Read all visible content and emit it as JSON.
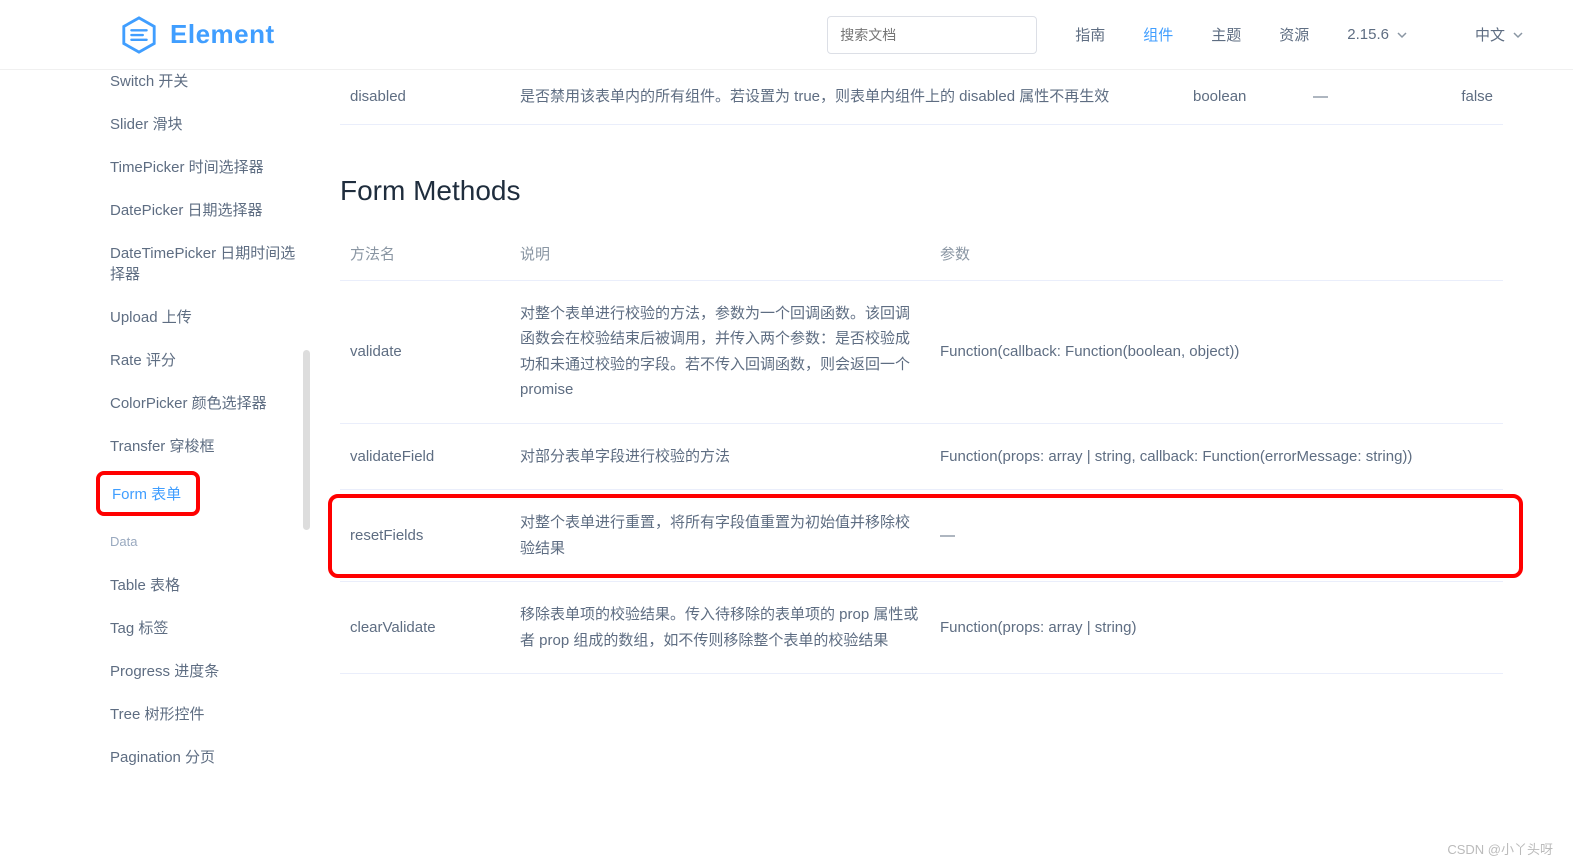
{
  "header": {
    "logo_text": "Element",
    "search_placeholder": "搜索文档",
    "nav": [
      "指南",
      "组件",
      "主题",
      "资源"
    ],
    "nav_active_index": 1,
    "version": "2.15.6",
    "language": "中文"
  },
  "sidebar": {
    "items_top": [
      "Switch 开关",
      "Slider 滑块",
      "TimePicker 时间选择器",
      "DatePicker 日期选择器",
      "DateTimePicker 日期时间选择器",
      "Upload 上传",
      "Rate 评分",
      "ColorPicker 颜色选择器",
      "Transfer 穿梭框"
    ],
    "active_item": "Form 表单",
    "group_title": "Data",
    "items_bottom": [
      "Table 表格",
      "Tag 标签",
      "Progress 进度条",
      "Tree 树形控件",
      "Pagination 分页"
    ]
  },
  "attributes_row": {
    "name": "disabled",
    "desc": "是否禁用该表单内的所有组件。若设置为 true，则表单内组件上的 disabled 属性不再生效",
    "type": "boolean",
    "options": "—",
    "default": "false"
  },
  "section_title": "Form Methods",
  "methods_headers": {
    "name": "方法名",
    "desc": "说明",
    "params": "参数"
  },
  "methods": [
    {
      "name": "validate",
      "desc": "对整个表单进行校验的方法，参数为一个回调函数。该回调函数会在校验结束后被调用，并传入两个参数：是否校验成功和未通过校验的字段。若不传入回调函数，则会返回一个 promise",
      "params": "Function(callback: Function(boolean, object))"
    },
    {
      "name": "validateField",
      "desc": "对部分表单字段进行校验的方法",
      "params": "Function(props: array | string, callback: Function(errorMessage: string))"
    },
    {
      "name": "resetFields",
      "desc": "对整个表单进行重置，将所有字段值重置为初始值并移除校验结果",
      "params": "—"
    },
    {
      "name": "clearValidate",
      "desc": "移除表单项的校验结果。传入待移除的表单项的 prop 属性或者 prop 组成的数组，如不传则移除整个表单的校验结果",
      "params": "Function(props: array | string)"
    }
  ],
  "watermark": "CSDN @小丫头呀"
}
